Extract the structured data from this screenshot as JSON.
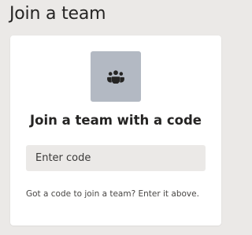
{
  "page": {
    "title": "Join a team"
  },
  "card": {
    "icon": "team-people-icon",
    "heading": "Join a team with a code",
    "code_input": {
      "value": "",
      "placeholder": "Enter code"
    },
    "hint": "Got a code to join a team? Enter it above."
  },
  "colors": {
    "background": "#ebe9e7",
    "card": "#ffffff",
    "icon_tile": "#b3b9c3",
    "input_background": "#ebe9e7",
    "text": "#252423"
  }
}
